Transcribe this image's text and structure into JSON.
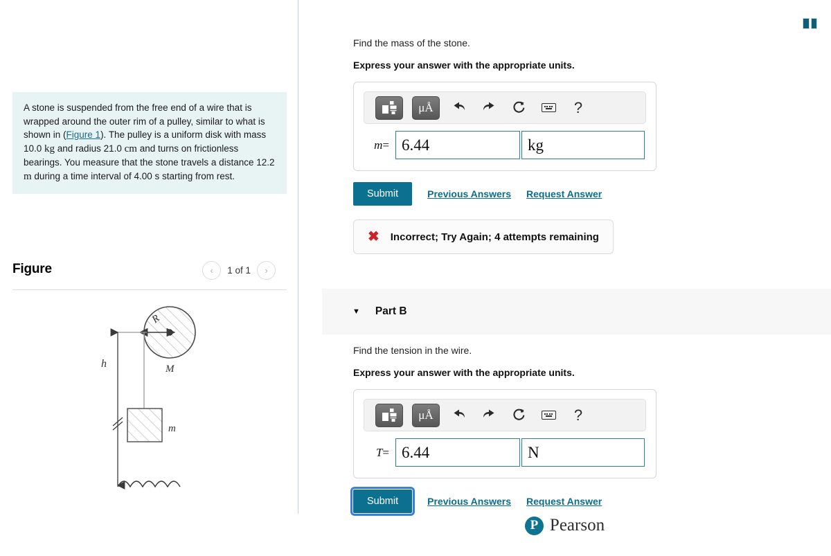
{
  "problem": {
    "text_part1": "A stone is suspended from the free end of a wire that is wrapped around the outer rim of a pulley, similar to what is shown in (",
    "figure_link": "Figure 1",
    "text_part2": "). The pulley is a uniform disk with mass 10.0 ",
    "unit_kg": "kg",
    "text_part3": " and radius 21.0 ",
    "unit_cm": "cm",
    "text_part4": " and turns on frictionless bearings. You measure that the stone travels a distance 12.2 ",
    "unit_m": "m",
    "text_part5": " during a time interval of 4.00 s starting from rest."
  },
  "figure": {
    "title": "Figure",
    "counter": "1 of 1",
    "prev_icon": "‹",
    "next_icon": "›",
    "labels": {
      "radius": "R",
      "pulley_mass": "M",
      "height": "h",
      "stone_mass": "m"
    }
  },
  "header": {
    "book_icon": "book-columns-icon"
  },
  "part_a": {
    "question": "Find the mass of the stone.",
    "instruction": "Express your answer with the appropriate units.",
    "variable": "m",
    "equals": "=",
    "value": "6.44",
    "units": "kg",
    "toolbar": {
      "template_icon": "fraction-template-icon",
      "unit_icon": "μÅ",
      "undo_icon": "undo-arrow-icon",
      "redo_icon": "redo-arrow-icon",
      "reset_icon": "↻",
      "keyboard_icon": "keyboard-icon",
      "help_icon": "?"
    },
    "submit_label": "Submit",
    "previous_answers_label": "Previous Answers",
    "request_answer_label": "Request Answer",
    "feedback_icon": "✖",
    "feedback_text": "Incorrect; Try Again; 4 attempts remaining"
  },
  "part_b": {
    "caret": "▼",
    "label": "Part B",
    "question": "Find the tension in the wire.",
    "instruction": "Express your answer with the appropriate units.",
    "variable": "T",
    "equals": "=",
    "value": "6.44",
    "units": "N",
    "toolbar": {
      "template_icon": "fraction-template-icon",
      "unit_icon": "μÅ",
      "undo_icon": "undo-arrow-icon",
      "redo_icon": "redo-arrow-icon",
      "reset_icon": "↻",
      "keyboard_icon": "keyboard-icon",
      "help_icon": "?"
    },
    "submit_label": "Submit",
    "previous_answers_label": "Previous Answers",
    "request_answer_label": "Request Answer"
  },
  "footer": {
    "logo_mark": "P",
    "logo_text": "Pearson"
  },
  "colors": {
    "accent_teal": "#0c7191",
    "link_teal": "#0c6e8c",
    "problem_bg": "#e8f4f4",
    "input_border": "#2a7fa0",
    "error_red": "#cc2128",
    "focus_blue": "#3b7fd4"
  }
}
